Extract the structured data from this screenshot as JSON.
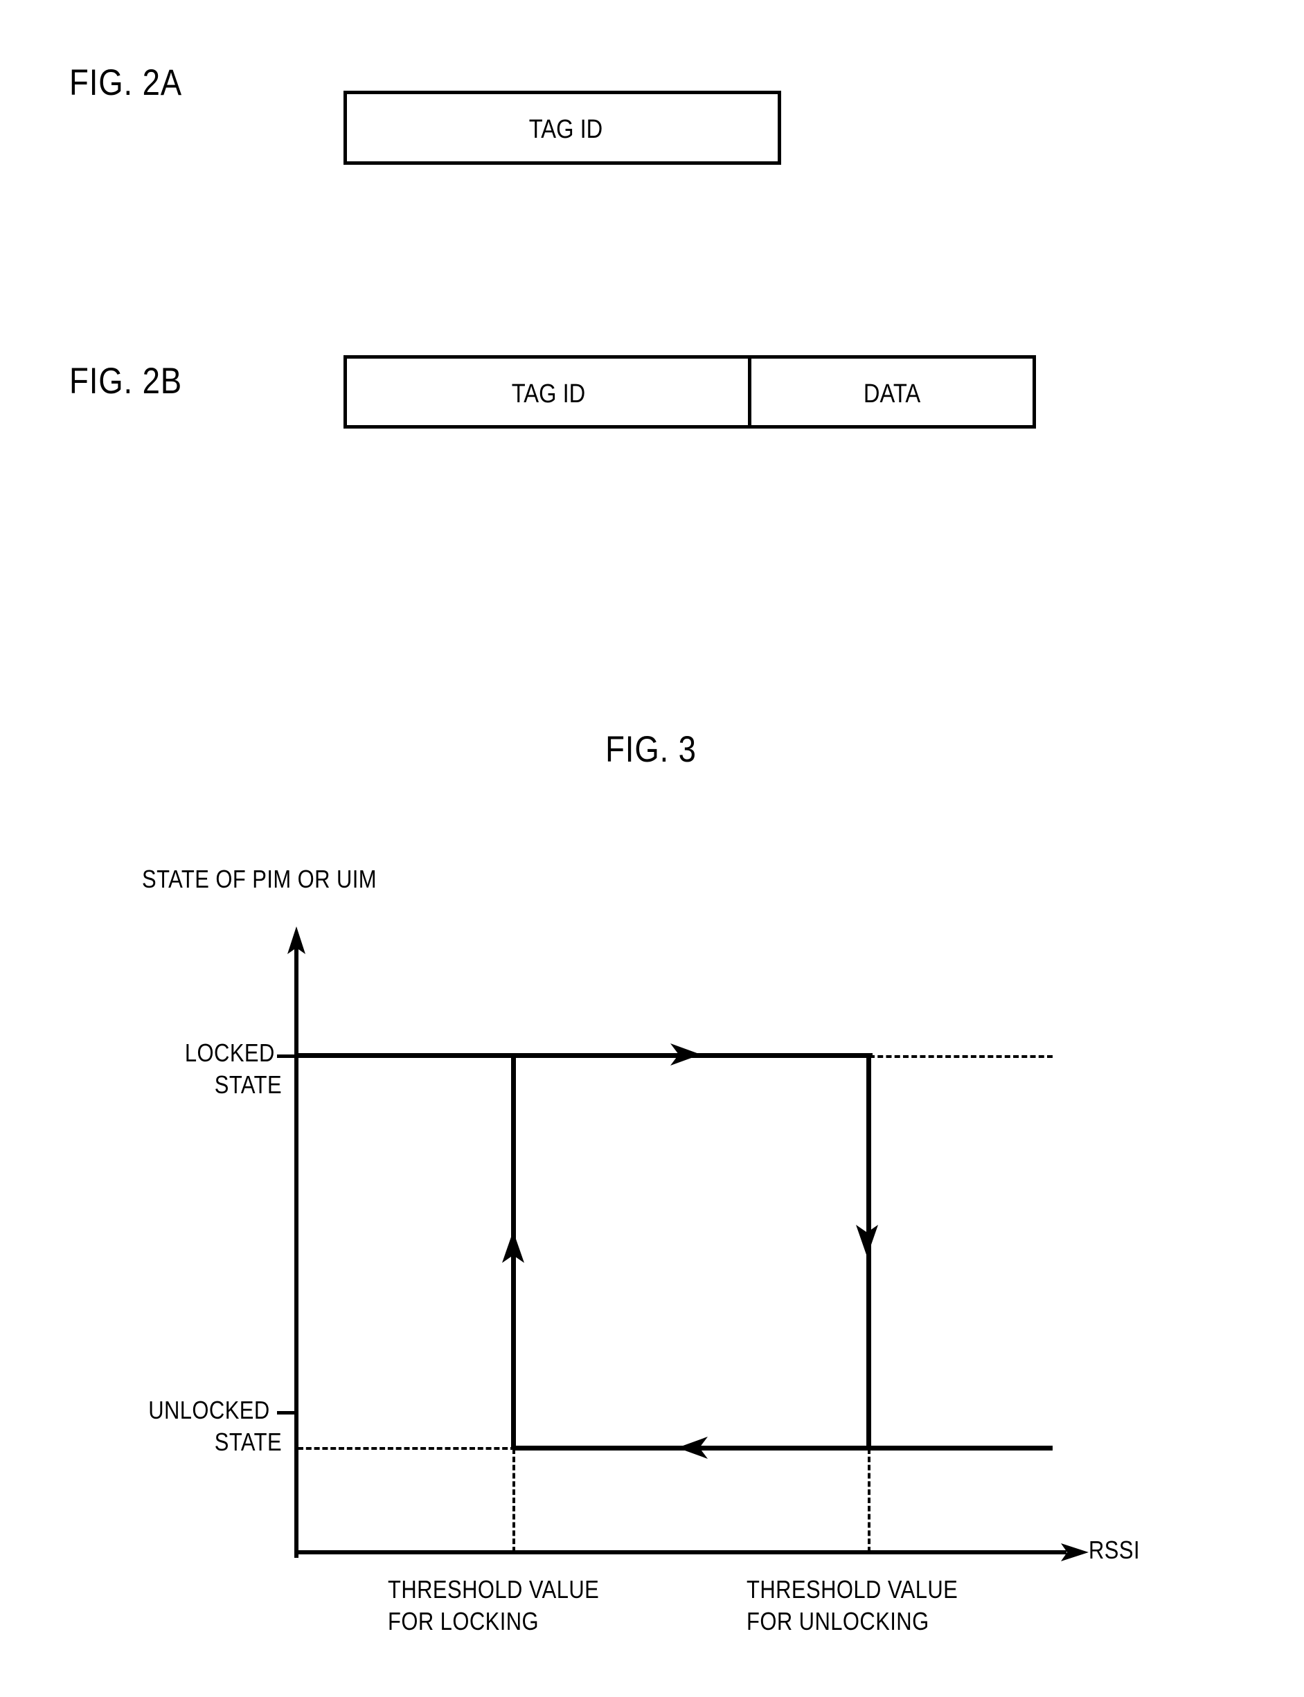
{
  "figures": [
    {
      "id": "fig-2a",
      "label": "FIG. 2A",
      "cells": [
        {
          "text": "TAG ID"
        }
      ]
    },
    {
      "id": "fig-2b",
      "label": "FIG. 2B",
      "cells": [
        {
          "text": "TAG ID"
        },
        {
          "text": "DATA"
        }
      ]
    },
    {
      "id": "fig-3",
      "label": "FIG. 3"
    }
  ],
  "fig2a": {
    "label": "FIG. 2A",
    "cell_1": "TAG ID"
  },
  "fig2b": {
    "label": "FIG. 2B",
    "cell_1": "TAG ID",
    "cell_2": "DATA"
  },
  "fig3": {
    "title": "FIG. 3",
    "y_axis_title": "STATE OF PIM OR UIM",
    "x_axis_title": "RSSI",
    "y_tick_high_line1": "LOCKED",
    "y_tick_high_line2": "STATE",
    "y_tick_low_line1": "UNLOCKED",
    "y_tick_low_line2": "STATE",
    "x_tick_left_line1": "THRESHOLD VALUE",
    "x_tick_left_line2": "FOR LOCKING",
    "x_tick_right_line1": "THRESHOLD VALUE",
    "x_tick_right_line2": "FOR UNLOCKING"
  },
  "colors": {
    "ink": "#000000",
    "paper": "#ffffff"
  },
  "chart_data": {
    "type": "line",
    "title": "FIG. 3",
    "xlabel": "RSSI",
    "ylabel": "STATE OF PIM OR UIM",
    "ytick_labels": [
      "UNLOCKED STATE",
      "LOCKED STATE"
    ],
    "ytick_values": [
      0,
      1
    ],
    "xtick_labels": [
      "THRESHOLD VALUE FOR LOCKING",
      "THRESHOLD VALUE FOR UNLOCKING"
    ],
    "xtick_values": [
      0.3,
      0.75
    ],
    "grid": false,
    "legend": false,
    "description": "Hysteresis loop of the PIM/UIM lock state versus RSSI",
    "series": [
      {
        "name": "locking branch (RSSI decreasing)",
        "direction": "right-to-left then up",
        "points": [
          {
            "x": 1.0,
            "y": 0
          },
          {
            "x": 0.3,
            "y": 0
          },
          {
            "x": 0.3,
            "y": 1
          },
          {
            "x": 1.0,
            "y": 1
          }
        ]
      },
      {
        "name": "unlocking branch (RSSI increasing)",
        "direction": "left-to-right then down",
        "points": [
          {
            "x": 0.0,
            "y": 1
          },
          {
            "x": 0.75,
            "y": 1
          },
          {
            "x": 0.75,
            "y": 0
          },
          {
            "x": 0.0,
            "y": 0
          }
        ]
      }
    ],
    "arrows": [
      {
        "at_x": 0.52,
        "at_y": 1,
        "direction": "right"
      },
      {
        "at_x": 0.75,
        "at_y": 0.52,
        "direction": "down"
      },
      {
        "at_x": 0.53,
        "at_y": 0,
        "direction": "left"
      },
      {
        "at_x": 0.3,
        "at_y": 0.52,
        "direction": "up"
      }
    ]
  }
}
